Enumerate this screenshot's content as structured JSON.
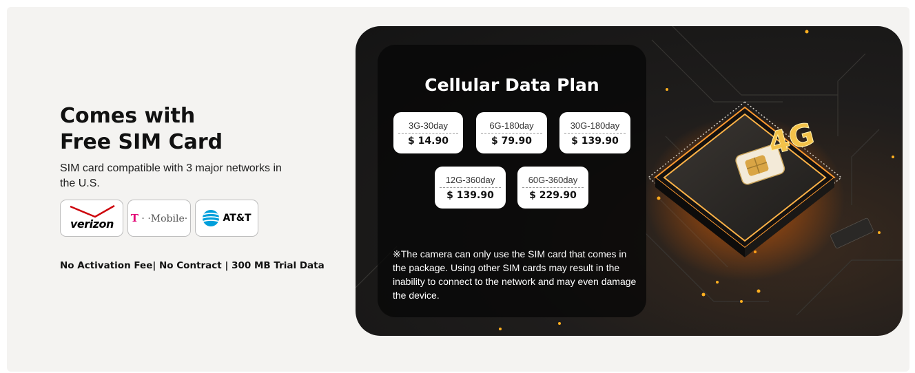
{
  "left": {
    "headline_line1": "Comes with",
    "headline_line2": "Free SIM Card",
    "subtitle": "SIM card compatible with 3 major networks in the U.S.",
    "carriers": [
      {
        "name": "verizon",
        "icon": "verizon-logo"
      },
      {
        "name": "T · ·Mobile·",
        "icon": "t-mobile-logo"
      },
      {
        "name": "AT&T",
        "icon": "att-globe-logo"
      }
    ],
    "bottom_note": "No Activation Fee| No Contract | 300 MB Trial Data"
  },
  "hero": {
    "title": "Cellular Data Plan",
    "plans": [
      {
        "name": "3G-30day",
        "price": "$ 14.90"
      },
      {
        "name": "6G-180day",
        "price": "$ 79.90"
      },
      {
        "name": "30G-180day",
        "price": "$ 139.90"
      },
      {
        "name": "12G-360day",
        "price": "$ 139.90"
      },
      {
        "name": "60G-360day",
        "price": "$ 229.90"
      }
    ],
    "note": "※The camera can only use the SIM card that comes in the package. Using other SIM cards may result in the inability to connect to the network and may even damage the device.",
    "chip_label": "4G",
    "colors": {
      "accent_orange": "#ff8a1e",
      "chip_gold": "#f3c24a",
      "panel_bg": "#f4f3f1"
    }
  }
}
